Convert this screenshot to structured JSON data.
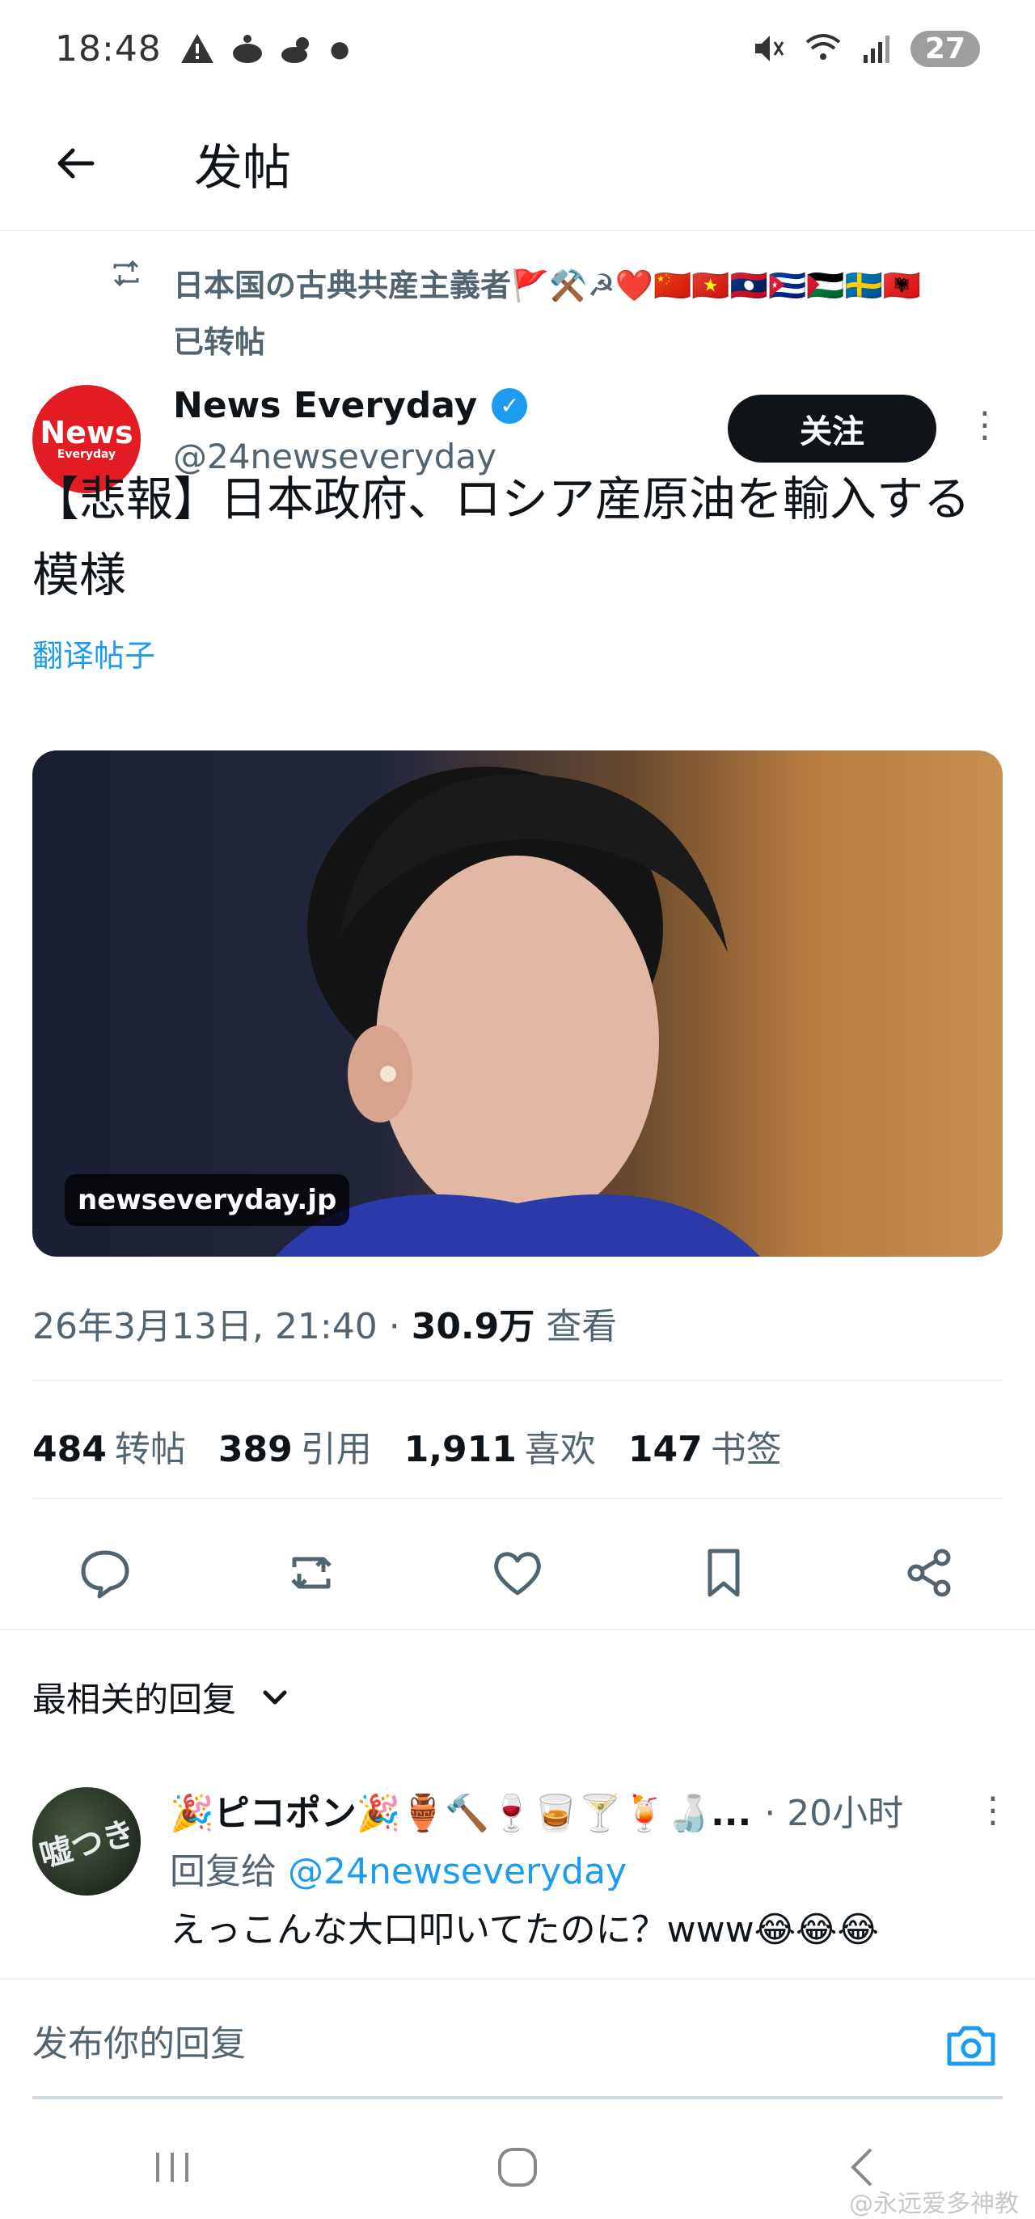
{
  "status_bar": {
    "time": "18:48",
    "battery": "27"
  },
  "header": {
    "title": "发帖"
  },
  "repost": {
    "user_line": "日本国の古典共産主義者🚩⚒️☭❤️🇨🇳🇻🇳🇱🇦🇨🇺🇵🇸🇸🇪🇦🇱",
    "status": "已转帖"
  },
  "author": {
    "avatar_text_big": "News",
    "avatar_text_small": "Everyday",
    "name": "News Everyday",
    "handle": "@24newseveryday",
    "follow_label": "关注"
  },
  "post": {
    "text_line1": "【悲報】日本政府、ロシア産原油を輸入する",
    "text_line2": "模様",
    "translate": "翻译帖子",
    "media_link": "newseveryday.jp"
  },
  "meta": {
    "timestamp": "26年3月13日, 21:40 · ",
    "views": "30.9万",
    "views_label": "查看"
  },
  "stats": [
    {
      "num": "484",
      "label": "转帖"
    },
    {
      "num": "389",
      "label": "引用"
    },
    {
      "num": "1,911",
      "label": "喜欢"
    },
    {
      "num": "147",
      "label": "书签"
    }
  ],
  "replies": {
    "header": "最相关的回复",
    "item": {
      "avatar_text": "嘘つき",
      "name": "🎉ピコポン🎉🏺🔨🍷🥃🍸🍹🍶...",
      "time": "· 20小时",
      "reply_to_label": "回复给 ",
      "reply_to_handle": "@24newseveryday",
      "text": "えっこんな大口叩いてたのに？www😂😂😂"
    }
  },
  "compose": {
    "placeholder": "发布你的回复"
  },
  "watermark": "@永远爱多神教"
}
